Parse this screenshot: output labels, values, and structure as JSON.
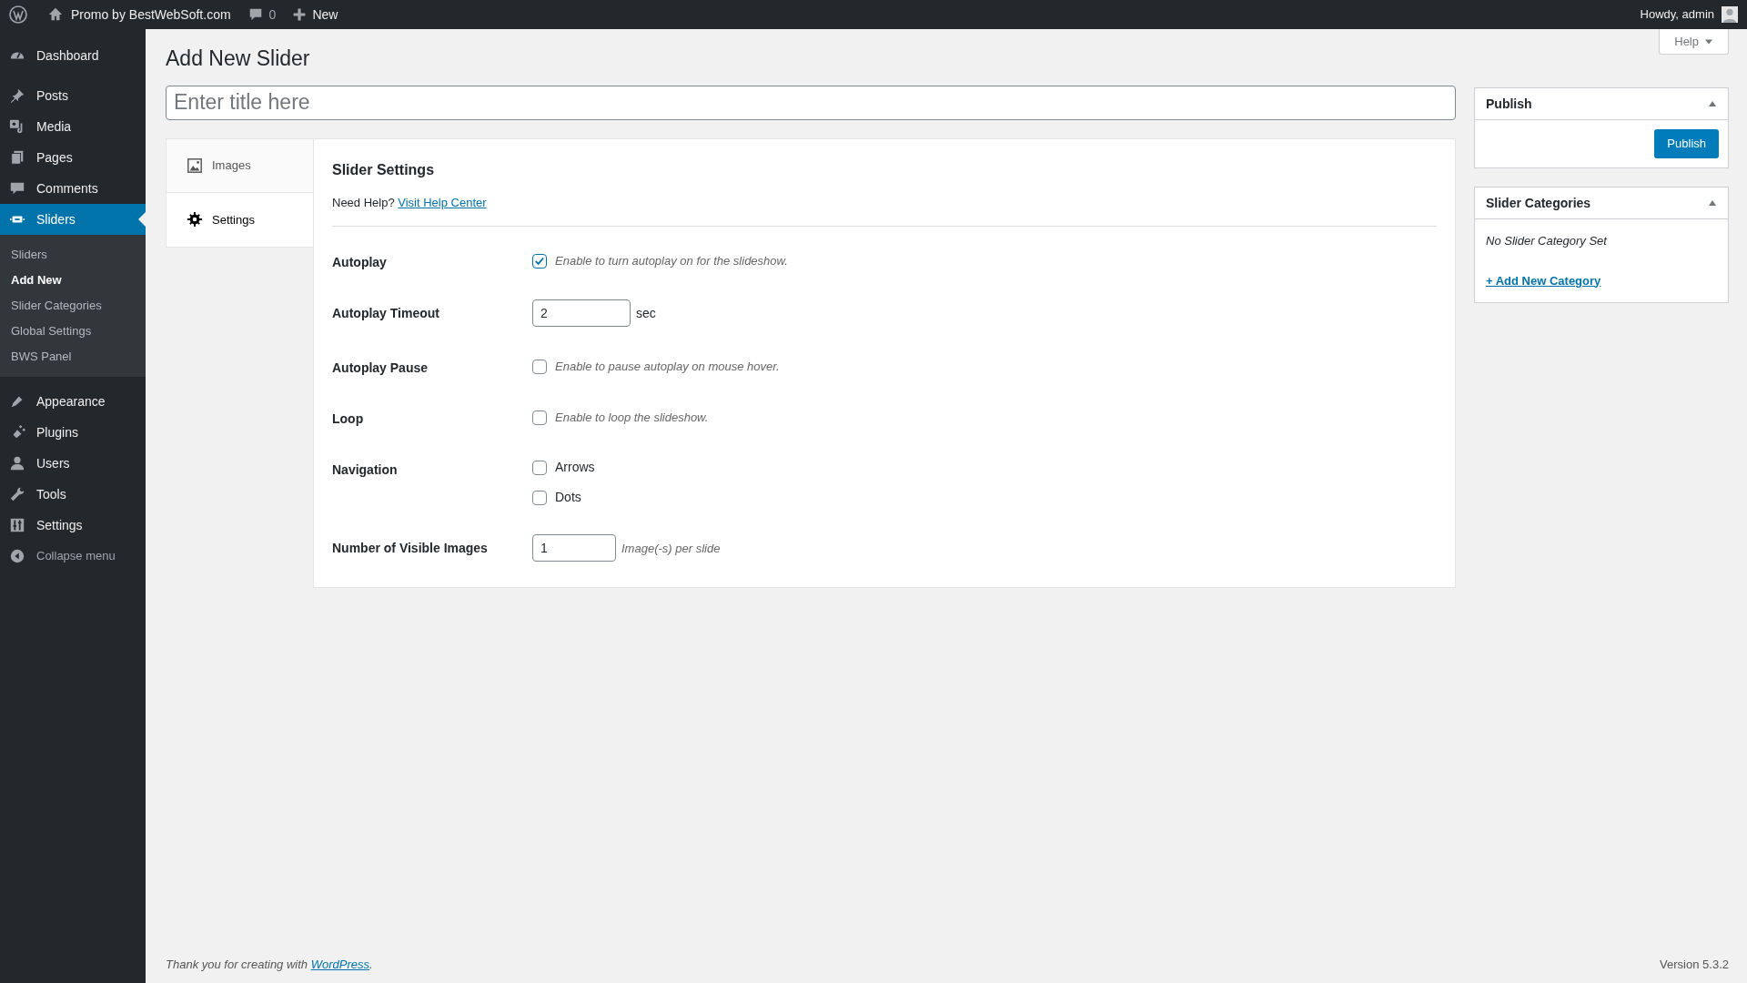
{
  "admin_bar": {
    "site_name": "Promo by BestWebSoft.com",
    "comments_count": "0",
    "new_label": "New",
    "greeting": "Howdy, admin"
  },
  "sidebar": {
    "items": [
      {
        "label": "Dashboard",
        "selected": false
      },
      {
        "label": "Posts",
        "selected": false
      },
      {
        "label": "Media",
        "selected": false
      },
      {
        "label": "Pages",
        "selected": false
      },
      {
        "label": "Comments",
        "selected": false
      },
      {
        "label": "Sliders",
        "selected": true,
        "children": [
          {
            "label": "Sliders",
            "selected": false
          },
          {
            "label": "Add New",
            "selected": true
          },
          {
            "label": "Slider Categories",
            "selected": false
          },
          {
            "label": "Global Settings",
            "selected": false
          },
          {
            "label": "BWS Panel",
            "selected": false
          }
        ]
      },
      {
        "label": "Appearance",
        "selected": false
      },
      {
        "label": "Plugins",
        "selected": false
      },
      {
        "label": "Users",
        "selected": false
      },
      {
        "label": "Tools",
        "selected": false
      },
      {
        "label": "Settings",
        "selected": false
      }
    ],
    "collapse_label": "Collapse menu"
  },
  "help_button": "Help",
  "page_title": "Add New Slider",
  "title_field": {
    "placeholder": "Enter title here"
  },
  "tabs": [
    {
      "label": "Images",
      "selected": false
    },
    {
      "label": "Settings",
      "selected": true
    }
  ],
  "settings": {
    "heading": "Slider Settings",
    "help_text": "Need Help?",
    "help_link": "Visit Help Center",
    "fields": [
      {
        "kind": "checkbox",
        "label": "Autoplay",
        "checked": true,
        "description": "Enable to turn autoplay on for the slideshow."
      },
      {
        "kind": "number",
        "label": "Autoplay Timeout",
        "value": "2",
        "unit": "sec"
      },
      {
        "kind": "checkbox",
        "label": "Autoplay Pause",
        "checked": false,
        "description": "Enable to pause autoplay on mouse hover."
      },
      {
        "kind": "checkbox",
        "label": "Loop",
        "checked": false,
        "description": "Enable to loop the slideshow."
      },
      {
        "kind": "options",
        "label": "Navigation",
        "options": [
          {
            "label": "Arrows",
            "checked": false
          },
          {
            "label": "Dots",
            "checked": false
          }
        ]
      },
      {
        "kind": "number",
        "label": "Number of Visible Images",
        "value": "1",
        "hint": "Image(-s) per slide"
      }
    ]
  },
  "publish_box": {
    "title": "Publish",
    "button": "Publish"
  },
  "categories_box": {
    "title": "Slider Categories",
    "empty_text": "No Slider Category Set",
    "add_link": "+ Add New Category"
  },
  "footer": {
    "text": "Thank you for creating with",
    "link": "WordPress",
    "after": ".",
    "version": "Version 5.3.2"
  }
}
